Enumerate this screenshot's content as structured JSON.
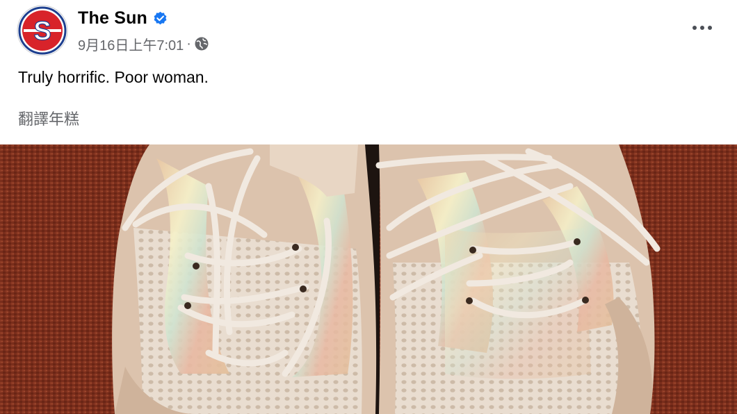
{
  "post": {
    "page_name": "The Sun",
    "timestamp": "9月16日上午7:01",
    "separator": "·",
    "caption": "Truly horrific. Poor woman.",
    "translate_link": "翻譯年糕",
    "avatar_letter": "S",
    "verified": true,
    "audience_icon": "globe-icon",
    "more_icon": "more-options-icon"
  },
  "colors": {
    "brand_red": "#d8232a",
    "verified_blue": "#1877f2",
    "secondary_text": "#65676b",
    "carpet": "#7a2e1c"
  },
  "photo": {
    "subject": "pair-of-sneakers"
  }
}
